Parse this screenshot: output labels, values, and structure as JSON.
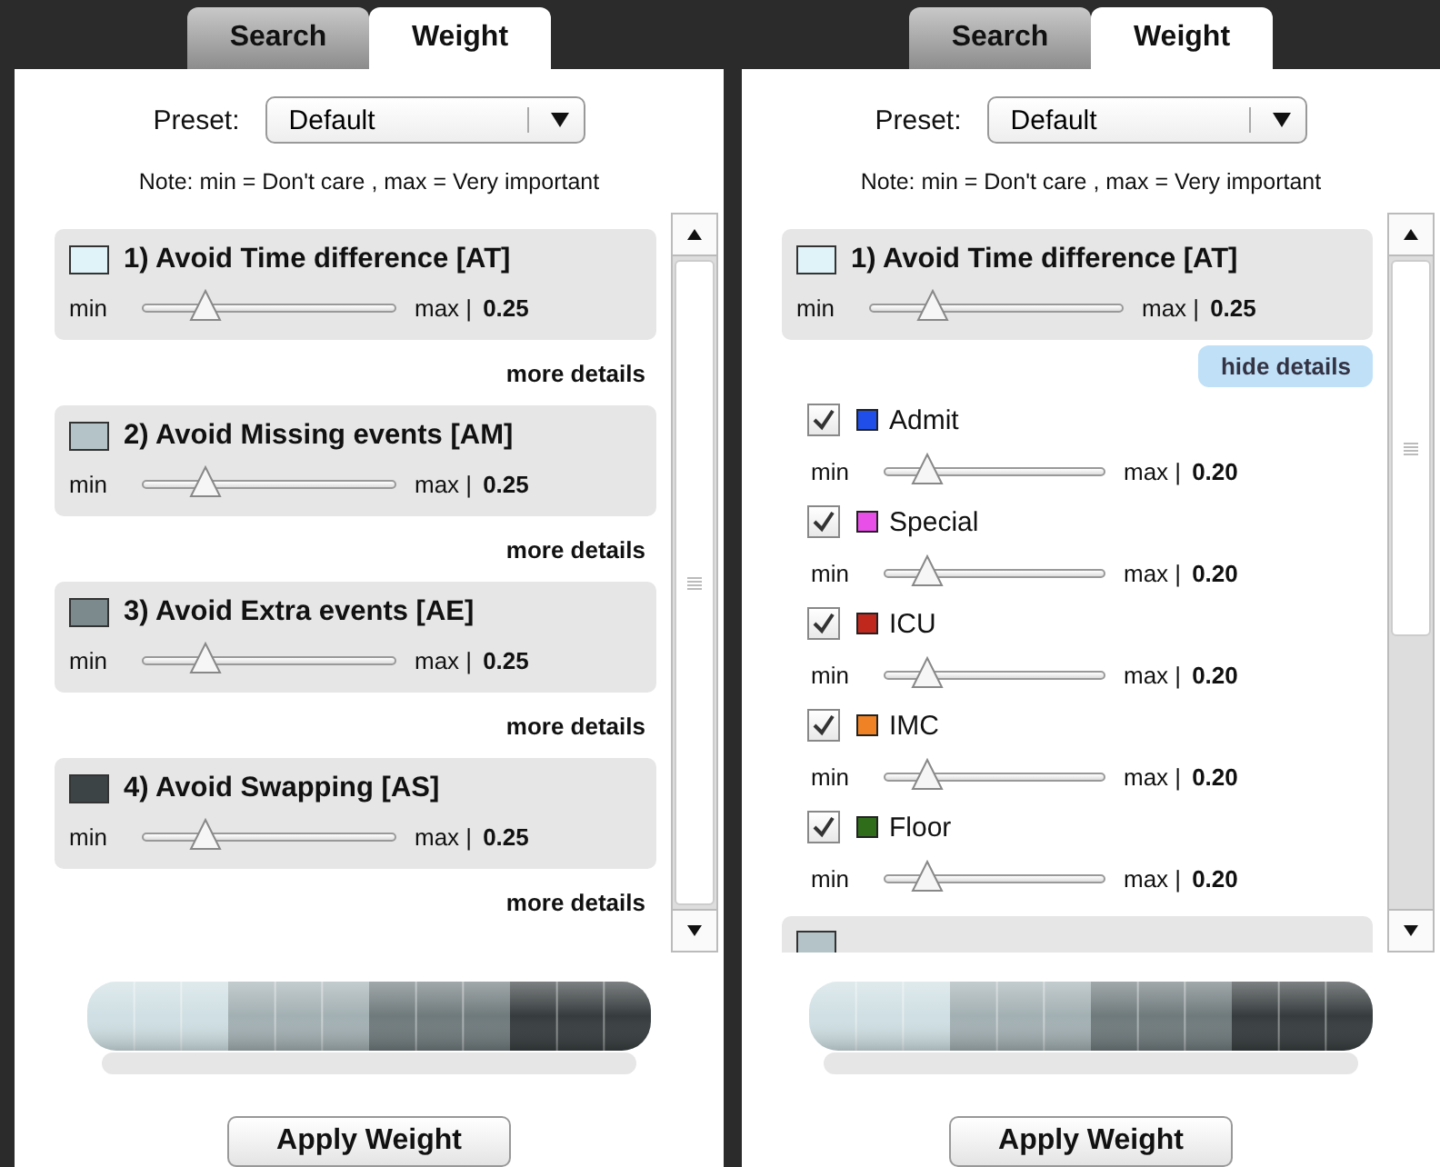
{
  "panels": [
    {
      "tabs": [
        {
          "label": "Search",
          "selected": false
        },
        {
          "label": "Weight",
          "selected": true
        }
      ],
      "preset": {
        "label": "Preset:",
        "value": "Default"
      },
      "note": "Note: min = Don't care , max = Very important",
      "criteria": [
        {
          "color": "#dff3f8",
          "title": "1) Avoid Time difference [AT]",
          "min": "min",
          "max": "max |",
          "level": 0.25,
          "reading": "0.25",
          "toggle": "more details",
          "expanded": false
        },
        {
          "color": "#b4c3c7",
          "title": "2) Avoid Missing events [AM]",
          "min": "min",
          "max": "max |",
          "level": 0.25,
          "reading": "0.25",
          "toggle": "more details",
          "expanded": false
        },
        {
          "color": "#7c8a8d",
          "title": "3) Avoid Extra events [AE]",
          "min": "min",
          "max": "max |",
          "level": 0.25,
          "reading": "0.25",
          "toggle": "more details",
          "expanded": false
        },
        {
          "color": "#3d4446",
          "title": "4) Avoid Swapping [AS]",
          "min": "min",
          "max": "max |",
          "level": 0.25,
          "reading": "0.25",
          "toggle": "more details",
          "expanded": false
        }
      ],
      "apply": "Apply Weight"
    },
    {
      "tabs": [
        {
          "label": "Search",
          "selected": false
        },
        {
          "label": "Weight",
          "selected": true
        }
      ],
      "preset": {
        "label": "Preset:",
        "value": "Default"
      },
      "note": "Note: min = Don't care , max = Very important",
      "criteria": [
        {
          "color": "#dff3f8",
          "title": "1) Avoid Time difference [AT]",
          "min": "min",
          "max": "max |",
          "level": 0.25,
          "reading": "0.25",
          "toggle": "hide details",
          "expanded": true,
          "events": [
            {
              "label": "Admit",
              "checked": true,
              "color": "#1f4fe8",
              "min": "min",
              "max": "max |",
              "level": 0.2,
              "reading": "0.20"
            },
            {
              "label": "Special",
              "checked": true,
              "color": "#e84fe8",
              "min": "min",
              "max": "max |",
              "level": 0.2,
              "reading": "0.20"
            },
            {
              "label": "ICU",
              "checked": true,
              "color": "#c0281e",
              "min": "min",
              "max": "max |",
              "level": 0.2,
              "reading": "0.20"
            },
            {
              "label": "IMC",
              "checked": true,
              "color": "#ef8224",
              "min": "min",
              "max": "max |",
              "level": 0.2,
              "reading": "0.20"
            },
            {
              "label": "Floor",
              "checked": true,
              "color": "#2f6d1a",
              "min": "min",
              "max": "max |",
              "level": 0.2,
              "reading": "0.20"
            }
          ]
        },
        {
          "color": "#b4c3c7",
          "kind": "hidden"
        }
      ],
      "apply": "Apply Weight"
    }
  ]
}
